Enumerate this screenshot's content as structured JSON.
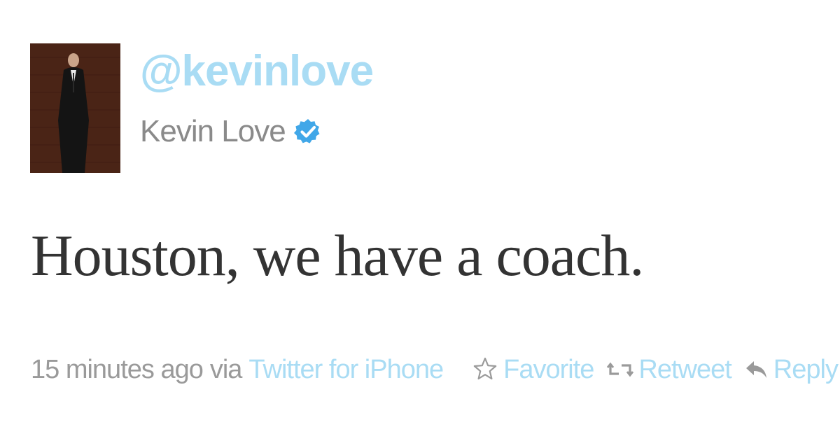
{
  "author": {
    "handle": "@kevinlove",
    "full_name": "Kevin Love",
    "verified": true,
    "avatar_icon": "profile-photo"
  },
  "tweet": {
    "text": "Houston, we have a coach."
  },
  "meta": {
    "time_ago": "15 minutes ago",
    "via_word": "via",
    "source": "Twitter for iPhone"
  },
  "actions": {
    "favorite_label": "Favorite",
    "retweet_label": "Retweet",
    "reply_label": "Reply"
  },
  "colors": {
    "link": "#a9dcf4",
    "muted": "#9a9a9a",
    "body_text": "#333333",
    "verified_badge": "#41a7e8"
  }
}
